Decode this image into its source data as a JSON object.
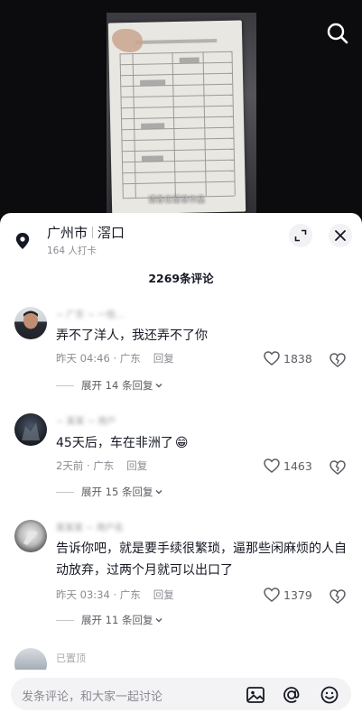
{
  "video": {
    "subtitle": "请各位留意作品"
  },
  "location": {
    "city": "广州市",
    "district": "滘口",
    "checkins": "164 人打卡"
  },
  "comments_header": {
    "count": "2269条评论"
  },
  "comments": [
    {
      "name": "~ 广东 ~ 一些...",
      "text": "弄不了洋人，我还弄不了你",
      "time": "昨天 04:46 · 广东",
      "reply": "回复",
      "likes": "1838",
      "expand": "展开 14 条回复"
    },
    {
      "name": "~ 某某 ~ 用户",
      "text": "45天后，车在非洲了",
      "emoji": "😁",
      "time": "2天前 · 广东",
      "reply": "回复",
      "likes": "1463",
      "expand": "展开 15 条回复"
    },
    {
      "name": "某某某 ~ 用户名",
      "text": "告诉你吧，就是要手续很繁琐，逼那些闲麻烦的人自动放弃，过两个月就可以出口了",
      "time": "昨天 03:34 · 广东",
      "reply": "回复",
      "likes": "1379",
      "expand": "展开 11 条回复"
    }
  ],
  "pinned": {
    "label": "已置顶"
  },
  "input": {
    "placeholder": "发条评论，和大家一起讨论"
  },
  "icons": {
    "search": "search-icon",
    "pin": "location-pin-icon",
    "expand": "expand-icon",
    "close": "close-icon",
    "like": "heart-icon",
    "dislike": "broken-heart-icon",
    "image": "image-icon",
    "mention": "at-icon",
    "emoji": "emoji-icon"
  }
}
